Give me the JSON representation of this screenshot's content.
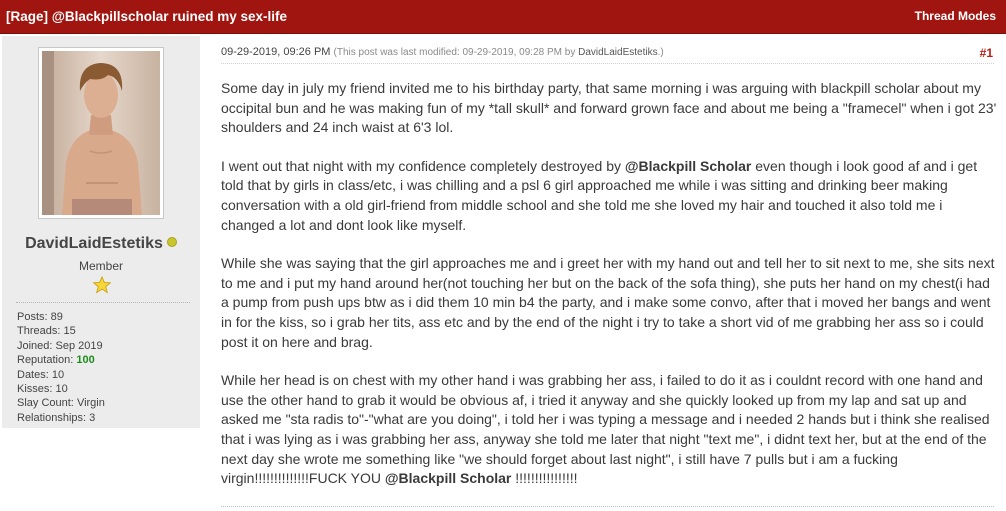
{
  "thread": {
    "title": "[Rage] @Blackpillscholar ruined my sex-life",
    "modes_label": "Thread Modes"
  },
  "user": {
    "name": "DavidLaidEstetiks",
    "title": "Member",
    "stats": {
      "posts_label": "Posts:",
      "posts": "89",
      "threads_label": "Threads:",
      "threads": "15",
      "joined_label": "Joined:",
      "joined": "Sep 2019",
      "reputation_label": "Reputation:",
      "reputation": "100",
      "dates_label": "Dates:",
      "dates": "10",
      "kisses_label": "Kisses:",
      "kisses": "10",
      "slay_label": "Slay Count:",
      "slay": "Virgin",
      "relationships_label": "Relationships:",
      "relationships": "3"
    }
  },
  "post": {
    "date": "09-29-2019, 09:26 PM",
    "edited_prefix": "(This post was last modified: 09-29-2019, 09:28 PM by ",
    "edited_user": "DavidLaidEstetiks",
    "edited_suffix": ".)",
    "number": "#1",
    "p1": "Some day in july my friend invited me to his birthday party, that same morning i was arguing with blackpill scholar about my occipital bun and he was making fun of my *tall skull* and forward grown face and about me being a \"framecel\" when i got 23' shoulders and 24 inch waist at 6'3 lol.",
    "p2_start": "I went out that night with my confidence completely destroyed by ",
    "mention_at": "@",
    "mention_name": "Blackpill Scholar",
    "p2_rest": " even though i look good af and i get told that by girls in class/etc, i was chilling and a psl 6 girl approached me while i was sitting and drinking beer making conversation with a old girl-friend from middle school and she told me she loved my hair and touched it also told me i changed a lot and dont look like myself.",
    "p3": "While she was saying that the girl approaches me and i greet her with my hand out and tell her to sit next to me, she sits next to me and i put my hand around her(not touching her but on the back of the sofa thing), she puts her hand on my chest(i had a pump from push ups btw as i did them 10 min b4 the party, and i make some convo, after that i moved her bangs and went in for the kiss, so i grab her tits, ass etc and by the end of the night i try to take a short vid of me grabbing her ass so i could post it on here and brag.",
    "p4_start": "While her head is on chest with my other hand i was grabbing her ass, i failed to do it as i couldnt record with one hand and use the other hand to grab it would be obvious af, i tried it anyway and she quickly looked up from my lap and sat up and asked me \"sta radis to\"-\"what are you doing\", i told her i was typing a message and i needed 2 hands but i think she realised that i was lying as i was grabbing her ass, anyway she told me later that night \"text me\", i didnt text her, but at the end of the next day she wrote me something like \"we should forget about last night\", i still have 7 pulls but i am  a fucking virgin!!!!!!!!!!!!!!FUCK YOU ",
    "p4_end": " !!!!!!!!!!!!!!!!"
  },
  "colors": {
    "header": "#a0150f",
    "sidebar": "#ececec",
    "reputation": "#1d8e1d",
    "post_number": "#b81c14"
  }
}
